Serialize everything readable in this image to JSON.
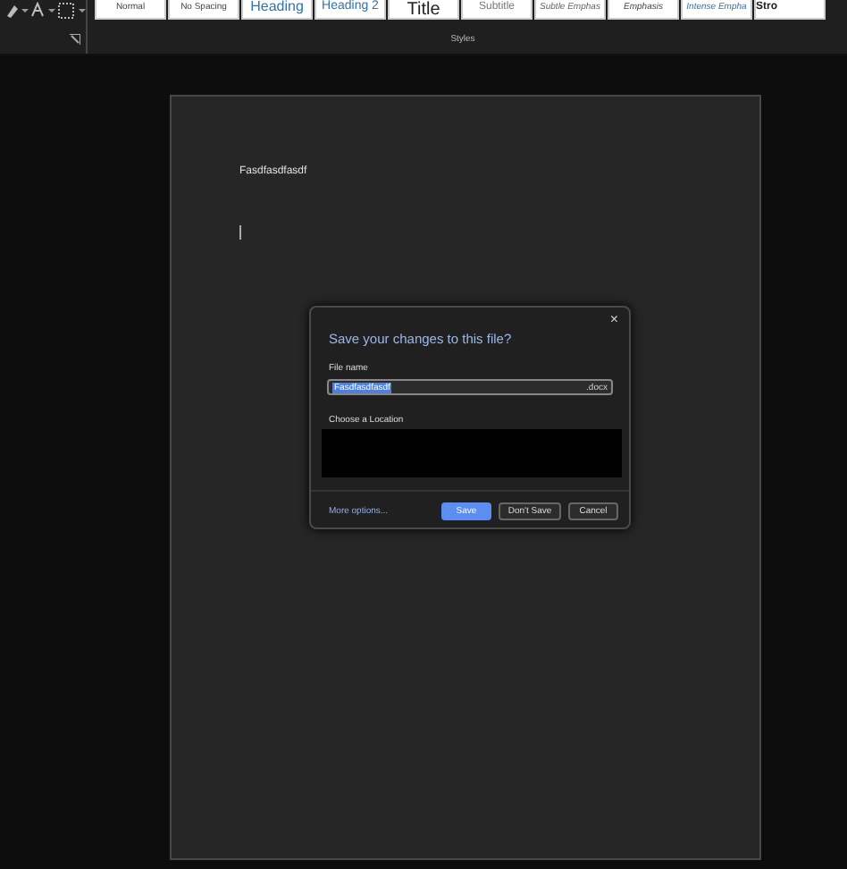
{
  "styles_gallery": {
    "label": "Styles",
    "items": [
      {
        "label": "Normal",
        "kind": "normal"
      },
      {
        "label": "No Spacing",
        "kind": "normal"
      },
      {
        "label": "Heading",
        "kind": "heading"
      },
      {
        "label": "Heading 2",
        "kind": "heading2"
      },
      {
        "label": "Title",
        "kind": "title"
      },
      {
        "label": "Subtitle",
        "kind": "subtitle"
      },
      {
        "label": "Subtle Emphas",
        "kind": "subtle"
      },
      {
        "label": "Emphasis",
        "kind": "emphasis"
      },
      {
        "label": "Intense Empha",
        "kind": "intense"
      },
      {
        "label": "Stro",
        "kind": "strong"
      }
    ]
  },
  "document": {
    "text": "Fasdfasdfasdf"
  },
  "dialog": {
    "title": "Save your changes to this file?",
    "close": "×",
    "file_name_label": "File name",
    "file_name": "Fasdfasdfasdf",
    "extension": ".docx",
    "location_label": "Choose a Location",
    "more_options": "More options...",
    "buttons": [
      {
        "label": "Save",
        "kind": "primary"
      },
      {
        "label": "Don't Save",
        "kind": "secondary"
      },
      {
        "label": "Cancel",
        "kind": "secondary"
      }
    ]
  }
}
